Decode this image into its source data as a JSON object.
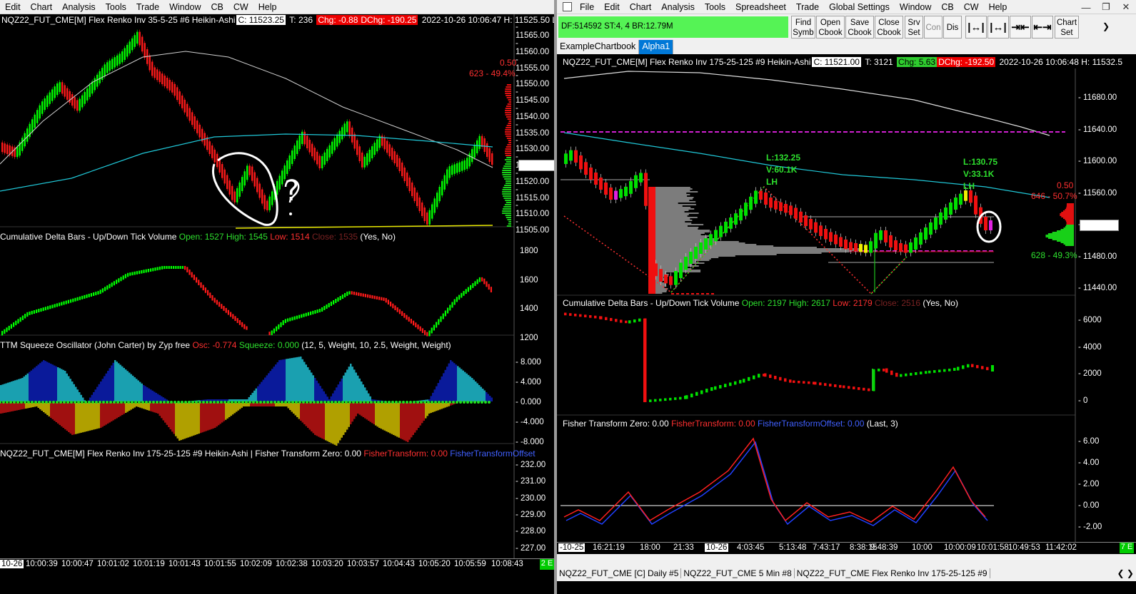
{
  "left": {
    "menu": [
      "Edit",
      "Chart",
      "Analysis",
      "Tools",
      "Trade",
      "Window",
      "CB",
      "CW",
      "Help"
    ],
    "header": {
      "symbol": "NQZ22_FUT_CME[M]  Flex Renko Inv 35-5-25  #6 Heikin-Ashi",
      "close": "C: 11523.25",
      "trades": "T: 236",
      "chg": "Chg: -0.88",
      "dchg": "DChg: -190.25",
      "datetime": "2022-10-26 10:06:47 H: 11525.50 L:"
    },
    "price_axis": [
      "11565.00",
      "11560.00",
      "11555.00",
      "11550.00",
      "11545.00",
      "11540.00",
      "11535.00",
      "11530.00",
      "11525.00",
      "11520.00",
      "11515.00",
      "11510.00",
      "11505.00"
    ],
    "current_price": "11523.25",
    "annot_right": [
      "0.50",
      "623 - 49.4%"
    ],
    "delta_label": {
      "name": "Cumulative Delta Bars - Up/Down Tick Volume",
      "open": "Open: 1527",
      "high": "High: 1545",
      "low": "Low: 1514",
      "close": "Close: 1535",
      "opts": "(Yes, No)"
    },
    "delta_axis": [
      "1800",
      "1600",
      "1400",
      "1200"
    ],
    "squeeze_label": {
      "name": "TTM Squeeze Oscillator (John Carter) by Zyp free",
      "osc": "Osc: -0.774",
      "sq": "Squeeze: 0.000",
      "opts": "(12, 5, Weight, 10, 2.5, Weight, Weight)"
    },
    "squeeze_axis": [
      "8.000",
      "4.000",
      "0.000",
      "-4.000",
      "-8.000"
    ],
    "fisher_label": {
      "name": "NQZ22_FUT_CME[M]  Flex Renko Inv 175-25-125  #9 Heikin-Ashi | Fisher Transform  Zero: 0.00",
      "ft": "FisherTransform: 0.00",
      "fto": "FisherTransformOffset"
    },
    "fisher_axis": [
      "232.00",
      "231.00",
      "230.00",
      "229.00",
      "228.00",
      "227.00"
    ],
    "time_axis": [
      "10-26",
      "10:00:39",
      "10:00:47",
      "10:01:02",
      "10:01:19",
      "10:01:43",
      "10:01:55",
      "10:02:09",
      "10:02:38",
      "10:03:20",
      "10:03:57",
      "10:04:43",
      "10:05:20",
      "10:05:59",
      "10:08:43"
    ],
    "corner": "2 E",
    "question_mark": "?"
  },
  "right": {
    "menu": [
      "File",
      "Edit",
      "Chart",
      "Analysis",
      "Tools",
      "Spreadsheet",
      "Trade",
      "Global Settings",
      "Window",
      "CB",
      "CW",
      "Help"
    ],
    "status": "DF:514592  ST:4, 4  BR:12.79M",
    "buttons": [
      {
        "l1": "Find",
        "l2": "Symb"
      },
      {
        "l1": "Open",
        "l2": "Cbook"
      },
      {
        "l1": "Save",
        "l2": "Cbook"
      },
      {
        "l1": "Close",
        "l2": "Cbook"
      },
      {
        "l1": "Srv",
        "l2": "Set"
      }
    ],
    "btn_con": "Con",
    "btn_dis": "Dis",
    "btn_chartset": {
      "l1": "Chart",
      "l2": "Set"
    },
    "tabs": [
      "ExampleChartbook",
      "Alpha1"
    ],
    "header": {
      "symbol": "NQZ22_FUT_CME[M]  Flex Renko Inv 175-25-125  #9 Heikin-Ashi",
      "close": "C: 11521.00",
      "trades": "T: 3121",
      "chg": "Chg: 5.63",
      "dchg": "DChg: -192.50",
      "datetime": "2022-10-26 10:06:48 H: 11532.5"
    },
    "price_axis": [
      "11680.00",
      "11640.00",
      "11600.00",
      "11560.00",
      "11520.00",
      "11480.00",
      "11440.00"
    ],
    "current_price": "11521.00",
    "annot_right": [
      "0.50",
      "646 - 50.7%",
      "628 - 49.3%"
    ],
    "swing1": [
      "L:132.25",
      "V:60.1K",
      "LH"
    ],
    "swing2": [
      "L:130.75",
      "V:33.1K",
      "LH"
    ],
    "delta_label": {
      "name": "Cumulative Delta Bars - Up/Down Tick Volume",
      "open": "Open: 2197",
      "high": "High: 2617",
      "low": "Low: 2179",
      "close": "Close: 2516",
      "opts": "(Yes, No)"
    },
    "delta_axis": [
      "6000",
      "4000",
      "2000",
      "0"
    ],
    "fisher_label": {
      "name": "Fisher Transform  Zero: 0.00",
      "ft": "FisherTransform: 0.00",
      "fto": "FisherTransformOffset: 0.00",
      "opts": "(Last, 3)"
    },
    "fisher_axis": [
      "6.00",
      "4.00",
      "2.00",
      "0.00",
      "-2.00"
    ],
    "time_axis": [
      "-10-25",
      "16:21:19",
      "18:00",
      "21:33",
      "10-26",
      "4:03:45",
      "5:13:48",
      "7:43:17",
      "8:38:15",
      "9:48:39",
      "10:00",
      "10:00:09",
      "10:01:58",
      "10:49:53",
      "11:42:02"
    ],
    "corner": "7 E",
    "bottom_tabs": [
      "NQZ22_FUT_CME [C]  Daily  #5",
      "NQZ22_FUT_CME  5 Min  #8",
      "NQZ22_FUT_CME  Flex Renko Inv 175-25-125  #9"
    ]
  }
}
